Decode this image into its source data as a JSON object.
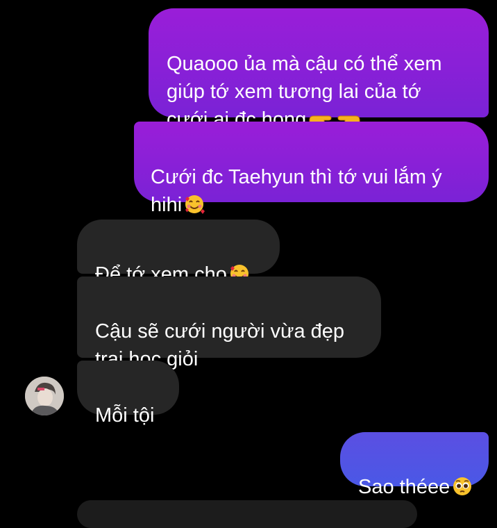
{
  "messages": [
    {
      "text": "Quaooo ủa mà cậu có thể xem\ngiúp tớ xem tương lai của tớ\ncưới ai đc hong",
      "emoji": "pointing-hands-icon",
      "direction": "outgoing"
    },
    {
      "text": "Cưới đc Taehyun thì tớ vui lắm ý\nhihi",
      "emoji": "smiling-face-with-hearts-icon",
      "direction": "outgoing"
    },
    {
      "text": "Để tớ xem cho",
      "emoji": "smiling-face-with-hearts-icon",
      "direction": "incoming"
    },
    {
      "text": "Cậu sẽ cưới người vừa đẹp\ntrai,học giỏi",
      "direction": "incoming"
    },
    {
      "text": "Mỗi tội",
      "direction": "incoming"
    },
    {
      "text": "Sao théee",
      "emoji": "pleading-face-icon",
      "direction": "outgoing"
    }
  ],
  "colors": {
    "background": "#000000",
    "outgoing_purple": "#8a1fd8",
    "outgoing_blue": "#4f55e4",
    "incoming": "#262626"
  }
}
